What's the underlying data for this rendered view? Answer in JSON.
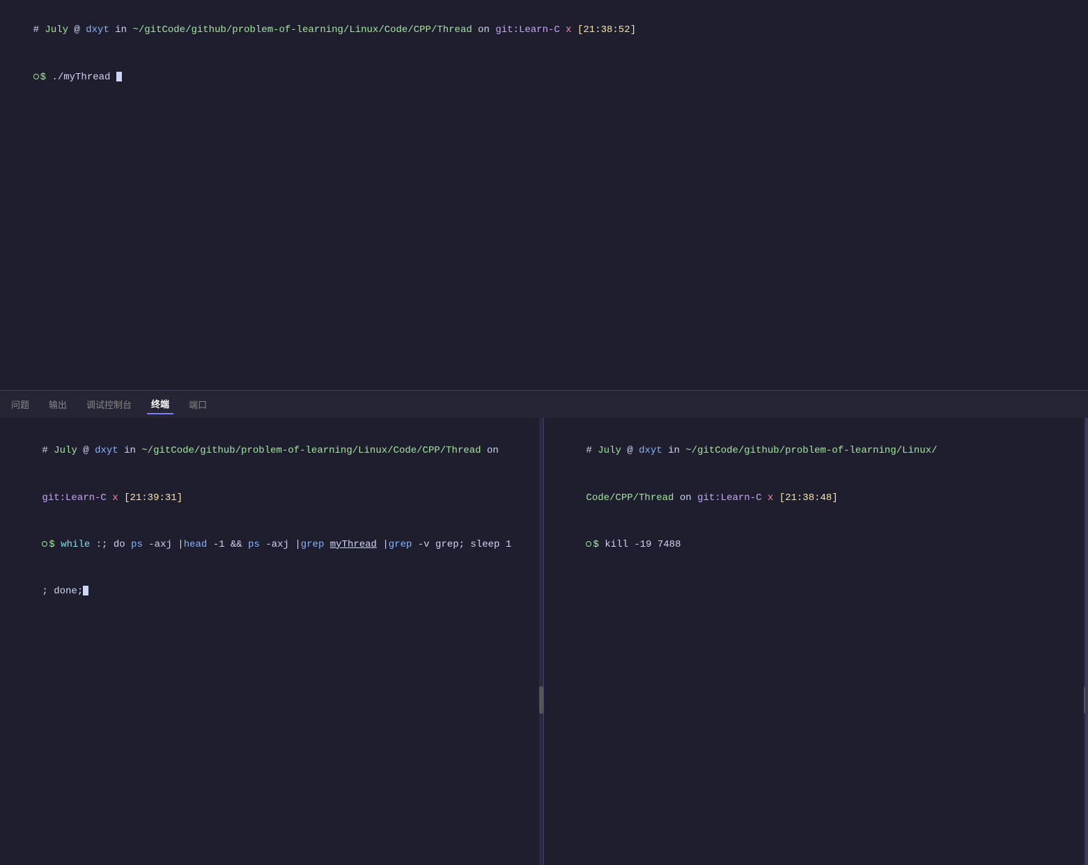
{
  "top_terminal": {
    "line1": {
      "hash": "# ",
      "july": "July",
      "at": " @ ",
      "user": "dxyt",
      "in": " in ",
      "path": "~/gitCode/github/problem-of-learning/Linux/Code/CPP/Thread",
      "on": " on ",
      "git": "git:Learn-C",
      "x": " x ",
      "time": "[21:38:52]"
    },
    "line2": {
      "prompt": "$ ",
      "cmd": "./myThread",
      "cursor": true
    }
  },
  "tabs": [
    {
      "label": "问题",
      "active": false
    },
    {
      "label": "输出",
      "active": false
    },
    {
      "label": "调试控制台",
      "active": false
    },
    {
      "label": "终端",
      "active": true
    },
    {
      "label": "端口",
      "active": false
    }
  ],
  "terminal_left": {
    "line1": {
      "hash": "# ",
      "july": "July",
      "at": " @ ",
      "user": "dxyt",
      "in": " in ",
      "path": "~/gitCode/github/problem-of-learning/Linux/Code/CPP/Thread",
      "on": " on"
    },
    "line1b": {
      "git": "git:Learn-C",
      "x": " x ",
      "time": "[21:39:31]"
    },
    "line2": {
      "prompt": "$ ",
      "cmd_while": "while",
      "rest": " :; do ",
      "ps1": "ps",
      "axj": " -axj |",
      "head": "head",
      "rest2": " -1 && ",
      "ps2": "ps",
      "axj2": " -axj |",
      "grep1": "grep",
      "mythread": "myThread",
      "pipe": " |",
      "grep2": "grep",
      "rest3": " -v grep; sleep 1"
    },
    "line3": {
      "text": "; done;"
    }
  },
  "terminal_right": {
    "line1": {
      "hash": "# ",
      "july": "July",
      "at": " @ ",
      "user": "dxyt",
      "in": " in ",
      "path": "~/gitCode/github/problem-of-learning/Linux/",
      "path2": "Code/CPP/Thread",
      "on": " on ",
      "git": "git:Learn-C",
      "x": " x ",
      "time": "[21:38:48]"
    },
    "line2": {
      "prompt": "$ ",
      "cmd": "kill -19 ",
      "pid": "7488"
    }
  },
  "colors": {
    "bg": "#1e1e2e",
    "tab_bg": "#252535",
    "border": "#3a3a5c",
    "split_border": "#44447a",
    "green": "#a6e3a1",
    "blue": "#89b4fa",
    "purple": "#cba6f7",
    "red": "#f38ba8",
    "yellow": "#f9e2af",
    "cyan": "#89dceb",
    "white": "#cdd6f4",
    "gray": "#6c7086",
    "orange": "#fab387"
  }
}
